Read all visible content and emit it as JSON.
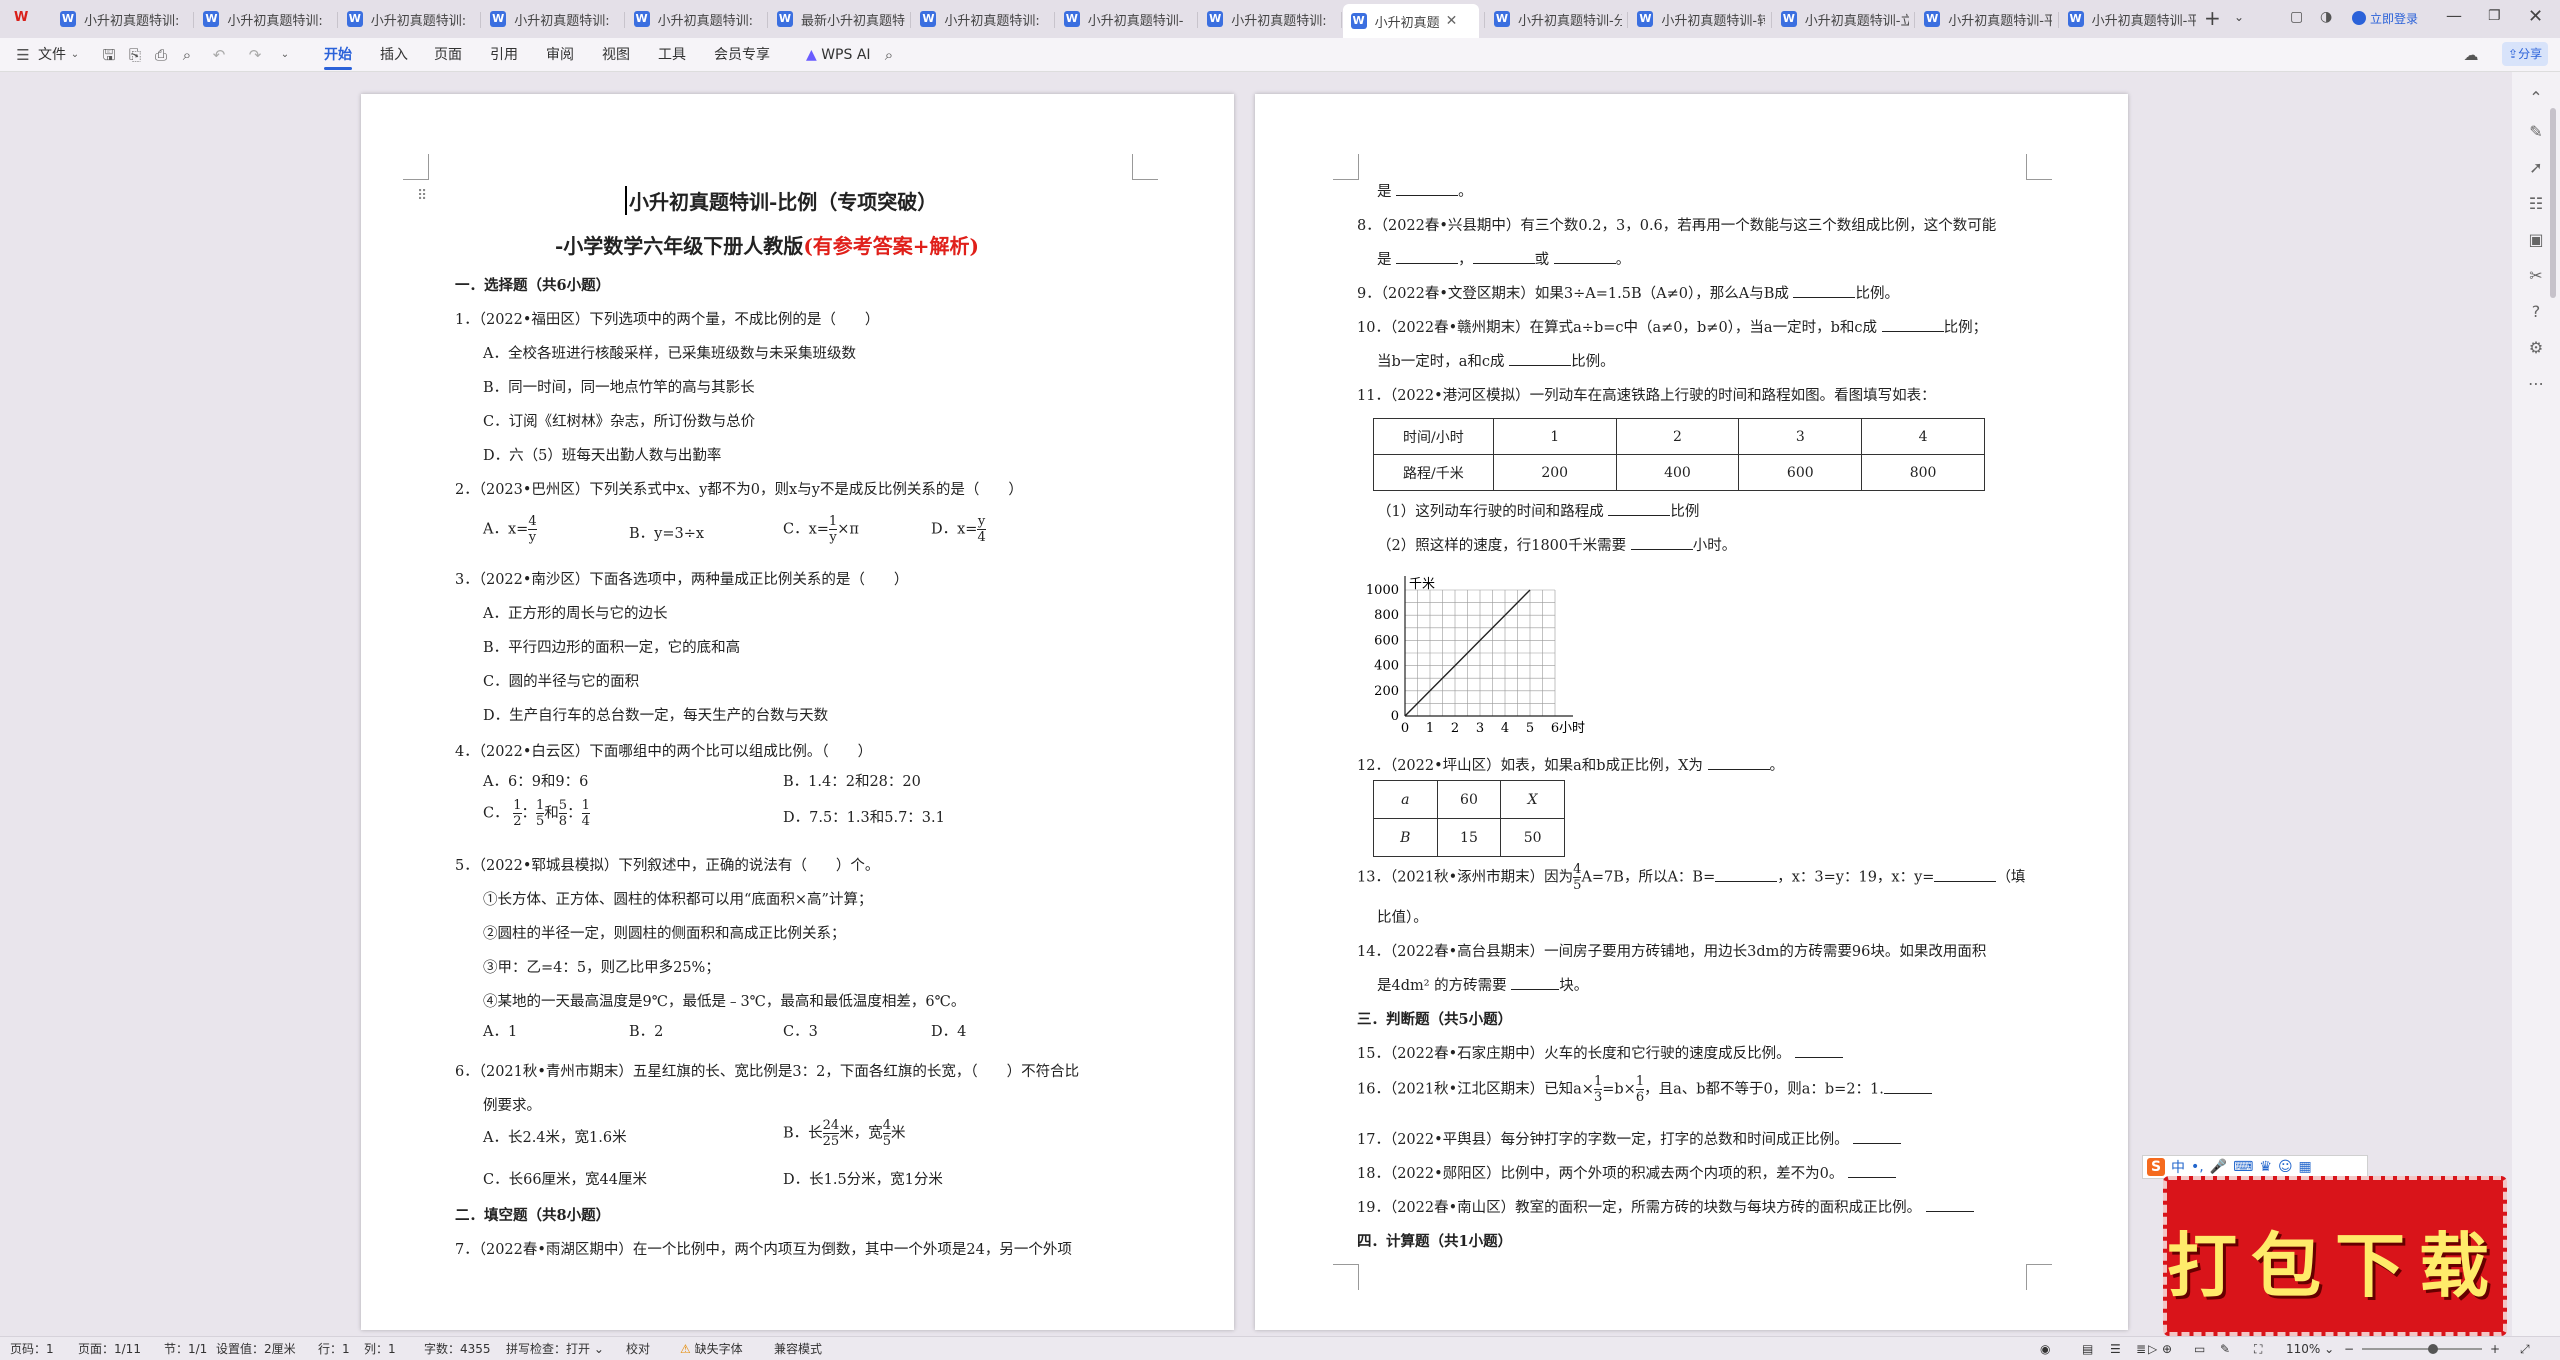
{
  "tabs": [
    {
      "label": "小升初真题特训:"
    },
    {
      "label": "小升初真题特训:"
    },
    {
      "label": "小升初真题特训:"
    },
    {
      "label": "小升初真题特训:"
    },
    {
      "label": "小升初真题特训:"
    },
    {
      "label": "最新小升初真题特"
    },
    {
      "label": "小升初真题特训:"
    },
    {
      "label": "小升初真题特训-"
    },
    {
      "label": "小升初真题特训:"
    },
    {
      "label": "小升初真题"
    },
    {
      "label": "小升初真题特训-分"
    },
    {
      "label": "小升初真题特训-转"
    },
    {
      "label": "小升初真题特训-立"
    },
    {
      "label": "小升初真题特训-平"
    },
    {
      "label": "小升初真题特训-平"
    }
  ],
  "window": {
    "login_label": "立即登录",
    "share_label": "分享"
  },
  "menu": {
    "file": "文件",
    "items": [
      "开始",
      "插入",
      "页面",
      "引用",
      "审阅",
      "视图",
      "工具",
      "会员专享"
    ],
    "wps_ai": "WPS AI"
  },
  "doc": {
    "title": "小升初真题特训-比例（专项突破）",
    "subtitle_black": "-小学数学六年级下册人教版",
    "subtitle_red": "(有参考答案+解析)",
    "left_lines": [
      "一．选择题（共6小题）",
      "1．（2022•福田区）下列选项中的两个量，不成比例的是（　　）",
      "A．全校各班进行核酸采样，已采集班级数与未采集班级数",
      "B．同一时间，同一地点竹竿的高与其影长",
      "C．订阅《红树林》杂志，所订份数与总价",
      "D．六（5）班每天出勤人数与出勤率",
      "2．（2023•巴州区）下列关系式中x、y都不为0，则x与y不是成反比例关系的是（　　）",
      "3．（2022•南沙区）下面各选项中，两种量成正比例关系的是（　　）",
      "A．正方形的周长与它的边长",
      "B．平行四边形的面积一定，它的底和高",
      "C．圆的半径与它的面积",
      "D．生产自行车的总台数一定，每天生产的台数与天数",
      "4．（2022•白云区）下面哪组中的两个比可以组成比例。（　　）",
      "5．（2022•郓城县模拟）下列叙述中，正确的说法有（　　）个。",
      "①长方体、正方体、圆柱的体积都可以用“底面积×高”计算；",
      "②圆柱的半径一定，则圆柱的侧面积和高成正比例关系；",
      "③甲：乙=4：5，则乙比甲多25%；",
      "④某地的一天最高温度是9℃，最低是﹣3℃，最高和最低温度相差，6℃。",
      "6．（2021秋•青州市期末）五星红旗的长、宽比例是3：2，下面各红旗的长宽，（　　）不符合比",
      "例要求。",
      "二．填空题（共8小题）",
      "7．（2022春•雨湖区期中）在一个比例中，两个内项互为倒数，其中一个外项是24，另一个外项"
    ],
    "q2_options": [
      "A．x=",
      "4",
      "y",
      "B．y=3÷x",
      "C．x=",
      "1",
      "y",
      "×π",
      "D．x=",
      "y",
      "4"
    ],
    "q4_options": [
      "A．6：9和9：6",
      "B．1.4：2和28：20",
      "C．",
      "1",
      "2",
      "：",
      "1",
      "5",
      "和",
      "5",
      "8",
      "：",
      "1",
      "4",
      "D．7.5：1.3和5.7：3.1"
    ],
    "q5_options": [
      "A．1",
      "B．2",
      "C．3",
      "D．4"
    ],
    "q6_options": [
      "A．长2.4米，宽1.6米",
      "B．长",
      "24",
      "25",
      "米，宽",
      "4",
      "5",
      "米",
      "C．长66厘米，宽44厘米",
      "D．长1.5分米，宽1分米"
    ],
    "right_lines": [
      "是",
      "8．（2022春•兴县期中）有三个数0.2，3，0.6，若再用一个数能与这三个数组成比例，这个数可能",
      "是",
      "或",
      "9．（2022春•文登区期末）如果3÷A=1.5B（A≠0），那么A与B成",
      "比例。",
      "10．（2022春•赣州期末）在算式a÷b=c中（a≠0，b≠0），当a一定时，b和c成",
      "比例；",
      "当b一定时，a和c成",
      "比例。",
      "11．（2022•港河区模拟）一列动车在高速铁路上行驶的时间和路程如图。看图填写如表：",
      "（1）这列动车行驶的时间和路程成",
      "比例",
      "（2）照这样的速度，行1800千米需要",
      "小时。",
      "12．（2022•坪山区）如表，如果a和b成正比例，X为",
      "13．（2021秋•涿州市期末）因为",
      "A=7B，所以A：B=",
      "，x：3=y：19，x：y=",
      "（填",
      "比值）。",
      "14．（2022春•高台县期末）一间房子要用方砖铺地，用边长3dm的方砖需要96块。如果改用面积",
      "是4dm² 的方砖需要",
      "块。",
      "三．判断题（共5小题）",
      "15．（2022春•石家庄期中）火车的长度和它行驶的速度成反比例。",
      "16．（2021秋•江北区期末）已知a×",
      "=b×",
      "，且a、b都不等于0，则a：b=2：1.",
      "17．（2022•平舆县）每分钟打字的字数一定，打字的总数和时间成正比例。",
      "18．（2022•郧阳区）比例中，两个外项的积减去两个内项的积，差不为0。",
      "19．（2022春•南山区）教室的面积一定，所需方砖的块数与每块方砖的面积成正比例。",
      "四．计算题（共1小题）"
    ],
    "table11": {
      "headers": [
        "时间/小时",
        "1",
        "2",
        "3",
        "4"
      ],
      "row": [
        "路程/千米",
        "200",
        "400",
        "600",
        "800"
      ]
    },
    "table12": {
      "row1": [
        "a",
        "60",
        "X"
      ],
      "row2": [
        "B",
        "15",
        "50"
      ]
    },
    "frac13": [
      "4",
      "5"
    ],
    "frac16": [
      "1",
      "3",
      "1",
      "6"
    ]
  },
  "chart_data": {
    "type": "line",
    "ylabel": "千米",
    "xlabel": "小时",
    "x": [
      0,
      1,
      2,
      3,
      4,
      5
    ],
    "y": [
      0,
      200,
      400,
      600,
      800,
      1000
    ],
    "xticks": [
      "0",
      "1",
      "2",
      "3",
      "4",
      "5",
      "6"
    ],
    "yticks": [
      "0",
      "200",
      "400",
      "600",
      "800",
      "1000"
    ],
    "xlim": [
      0,
      6
    ],
    "ylim": [
      0,
      1000
    ],
    "grid": true
  },
  "status": {
    "page": "页码：1",
    "pages": "页面：1/11",
    "section": "节：1/1",
    "setting": "设置值：2厘米",
    "row": "行：1",
    "col": "列：1",
    "words": "字数：4355",
    "spell": "拼写检查：打开",
    "proof": "校对",
    "font": "缺失字体",
    "compat": "兼容模式",
    "zoom": "110%"
  },
  "ime": {
    "label": "中"
  },
  "download": {
    "label": "打包下载"
  }
}
